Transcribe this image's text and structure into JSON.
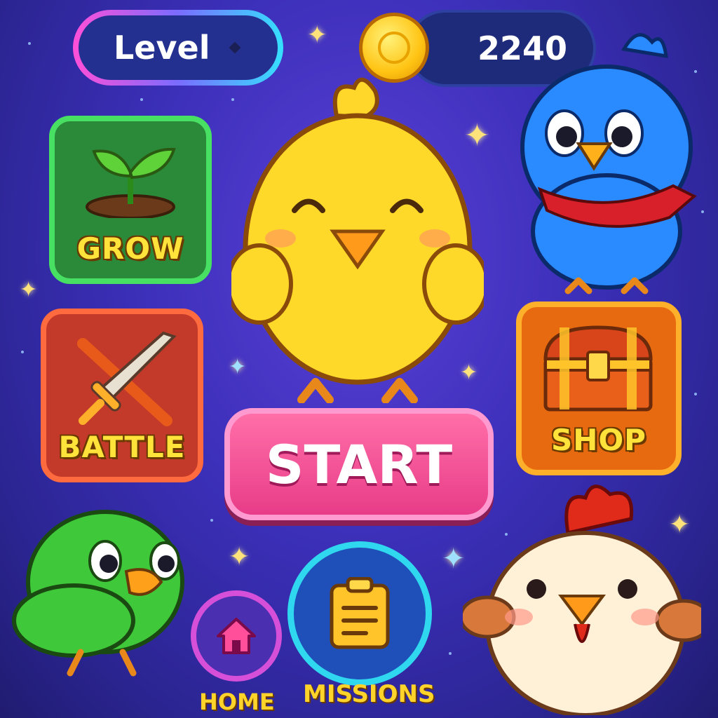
{
  "hud": {
    "level_label": "Level",
    "coins": "2240"
  },
  "menu": {
    "grow_label": "GROW",
    "battle_label": "BATTLE",
    "shop_label": "SHOP",
    "start_label": "START"
  },
  "nav": {
    "home_label": "HOME",
    "missions_label": "MISSIONS"
  },
  "colors": {
    "background": "#3b2fb8",
    "start": "#e83c88",
    "grow": "#2a8a3a",
    "battle": "#c43a2a",
    "shop": "#e86a10",
    "label_yellow": "#ffe33a"
  },
  "icons": {
    "grow": "sprout-icon",
    "battle": "sword-icon",
    "shop": "treasure-chest-icon",
    "home": "house-icon",
    "missions": "clipboard-icon",
    "coin": "coin-icon"
  }
}
